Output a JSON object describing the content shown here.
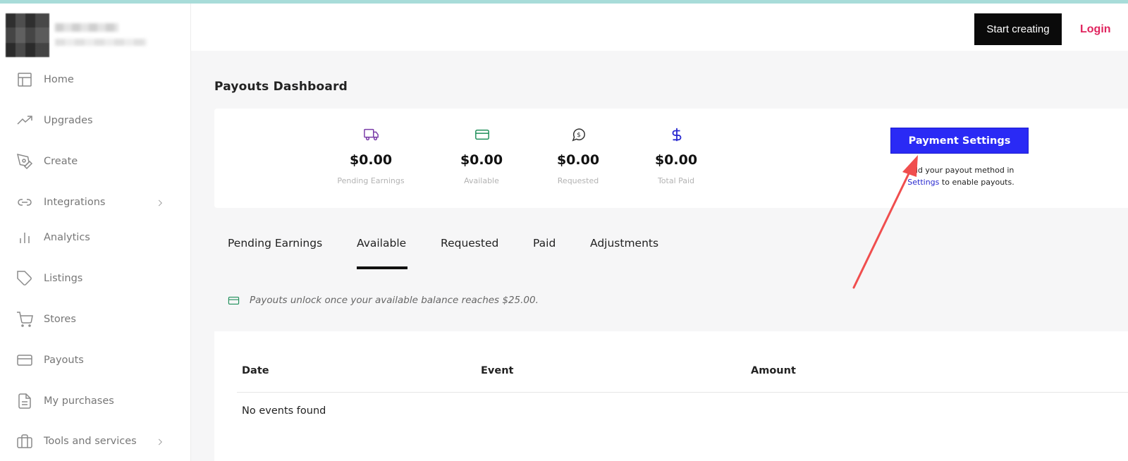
{
  "header": {
    "start_creating": "Start creating",
    "login": "Login"
  },
  "sidebar": {
    "items": [
      {
        "label": "Home",
        "icon": "layout-icon"
      },
      {
        "label": "Upgrades",
        "icon": "trending-up-icon"
      },
      {
        "label": "Create",
        "icon": "pen-tool-icon"
      },
      {
        "label": "Integrations",
        "icon": "link-icon",
        "has_submenu": true
      },
      {
        "label": "Analytics",
        "icon": "bar-chart-icon"
      },
      {
        "label": "Listings",
        "icon": "tag-icon"
      },
      {
        "label": "Stores",
        "icon": "cart-icon"
      },
      {
        "label": "Payouts",
        "icon": "card-icon"
      },
      {
        "label": "My purchases",
        "icon": "file-icon"
      },
      {
        "label": "Tools and services",
        "icon": "briefcase-icon",
        "has_submenu": true
      }
    ]
  },
  "main": {
    "title": "Payouts Dashboard",
    "stats": [
      {
        "amount": "$0.00",
        "caption": "Pending Earnings",
        "icon": "truck-icon",
        "color": "#7a3ca8"
      },
      {
        "amount": "$0.00",
        "caption": "Available",
        "icon": "card-icon",
        "color": "#1f8f5a"
      },
      {
        "amount": "$0.00",
        "caption": "Requested",
        "icon": "dollar-circle-icon",
        "color": "#333333"
      },
      {
        "amount": "$0.00",
        "caption": "Total Paid",
        "icon": "dollar-icon",
        "color": "#2a2ad0"
      }
    ],
    "payment_settings": {
      "button": "Payment Settings",
      "help_prefix": "Add your payout method in",
      "help_link": "Settings",
      "help_suffix": "to enable payouts."
    },
    "tabs": [
      "Pending Earnings",
      "Available",
      "Requested",
      "Paid",
      "Adjustments"
    ],
    "active_tab": "Available",
    "notice": "Payouts unlock once your available balance reaches $25.00.",
    "table": {
      "columns": [
        "Date",
        "Event",
        "Amount"
      ],
      "empty_text": "No events found"
    }
  },
  "colors": {
    "primary_button": "#2a2af5",
    "login": "#e0245e",
    "annotation_arrow": "#f04e4e"
  }
}
